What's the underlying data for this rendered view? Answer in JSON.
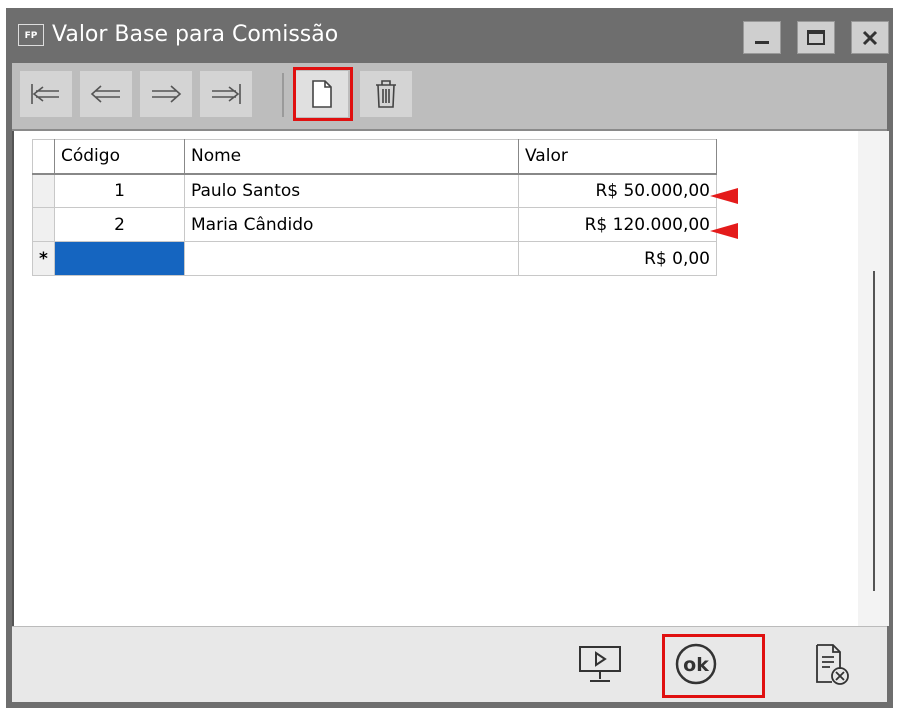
{
  "window": {
    "app_badge": "FP",
    "title": "Valor Base para Comissão",
    "controls": [
      "minimize-icon",
      "maximize-icon",
      "close-icon"
    ]
  },
  "toolbar": {
    "buttons": [
      "first-record-icon",
      "previous-record-icon",
      "next-record-icon",
      "last-record-icon",
      "new-document-icon",
      "trash-icon"
    ],
    "highlighted": "new-document-icon",
    "highlight_color": "#e01010"
  },
  "grid": {
    "columns": [
      "Código",
      "Nome",
      "Valor"
    ],
    "rows": [
      {
        "marker": "",
        "codigo": "1",
        "nome": "Paulo Santos",
        "valor": "R$ 50.000,00"
      },
      {
        "marker": "",
        "codigo": "2",
        "nome": "Maria Cândido",
        "valor": "R$ 120.000,00"
      },
      {
        "marker": "*",
        "codigo": "",
        "nome": "",
        "valor": "R$ 0,00"
      }
    ],
    "selected_cell_color": "#1565c0",
    "row_pointer_color": "#e41b1b"
  },
  "footer": {
    "buttons": [
      "presentation-icon",
      "ok-icon",
      "cancel-document-icon"
    ],
    "ok_label": "ok",
    "highlighted": "ok-icon"
  }
}
